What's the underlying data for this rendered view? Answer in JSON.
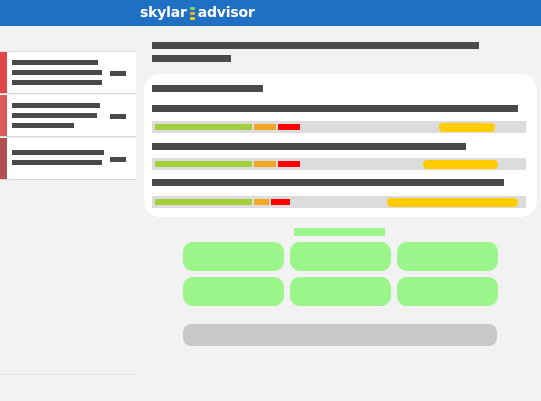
{
  "app": {
    "logo_part1": "skylar",
    "logo_part2": "advisor",
    "logo_mark_colors": [
      "#7ed957",
      "#f5a623",
      "#f5d000"
    ]
  },
  "colors": {
    "header": "#1f6fc5",
    "severity_critical": "#e04848",
    "severity_major": "#d85c5c",
    "severity_minor": "#b05050",
    "healthy": "#a4cf3c",
    "warning": "#f5a623",
    "critical": "#ff0000",
    "forecast": "#ffcc00",
    "action_button": "#9cf58b"
  },
  "sidebar": {
    "items": [
      {
        "severity": "critical"
      },
      {
        "severity": "major"
      },
      {
        "severity": "minor"
      }
    ]
  },
  "card": {
    "rows": [
      {
        "healthy": 0.26,
        "warning": 0.06,
        "critical": 0.06,
        "forecast": 0.15
      },
      {
        "healthy": 0.26,
        "warning": 0.06,
        "critical": 0.06,
        "forecast": 0.2
      },
      {
        "healthy": 0.26,
        "warning": 0.04,
        "critical": 0.05,
        "forecast": 0.35
      }
    ]
  }
}
